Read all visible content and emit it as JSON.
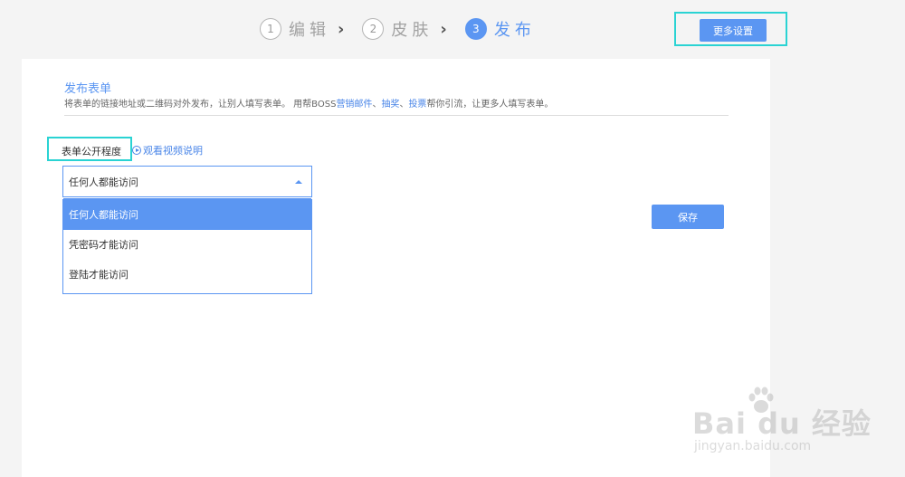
{
  "steps": [
    {
      "number": "1",
      "label": "编辑"
    },
    {
      "number": "2",
      "label": "皮肤"
    },
    {
      "number": "3",
      "label": "发布"
    }
  ],
  "header": {
    "more_settings_label": "更多设置"
  },
  "section": {
    "title": "发布表单",
    "desc_prefix": "将表单的链接地址或二维码对外发布，让别人填写表单。 用帮BOSS",
    "link_email": "营销邮件",
    "sep1": "、",
    "link_lottery": "抽奖",
    "sep2": "、",
    "link_vote": "投票",
    "desc_suffix": "帮你引流，让更多人填写表单。"
  },
  "field": {
    "label": "表单公开程度",
    "video_link": "观看视频说明",
    "selected_value": "任何人都能访问",
    "options": [
      {
        "label": "任何人都能访问"
      },
      {
        "label": "凭密码才能访问"
      },
      {
        "label": "登陆才能访问"
      }
    ]
  },
  "actions": {
    "save_label": "保存"
  },
  "watermark": {
    "brand": "Bai du 经验",
    "url": "jingyan.baidu.com"
  },
  "colors": {
    "accent": "#5b96f2",
    "highlight": "#2ad3d3",
    "page_bg": "#f4f4f4",
    "card_bg": "#ffffff"
  }
}
